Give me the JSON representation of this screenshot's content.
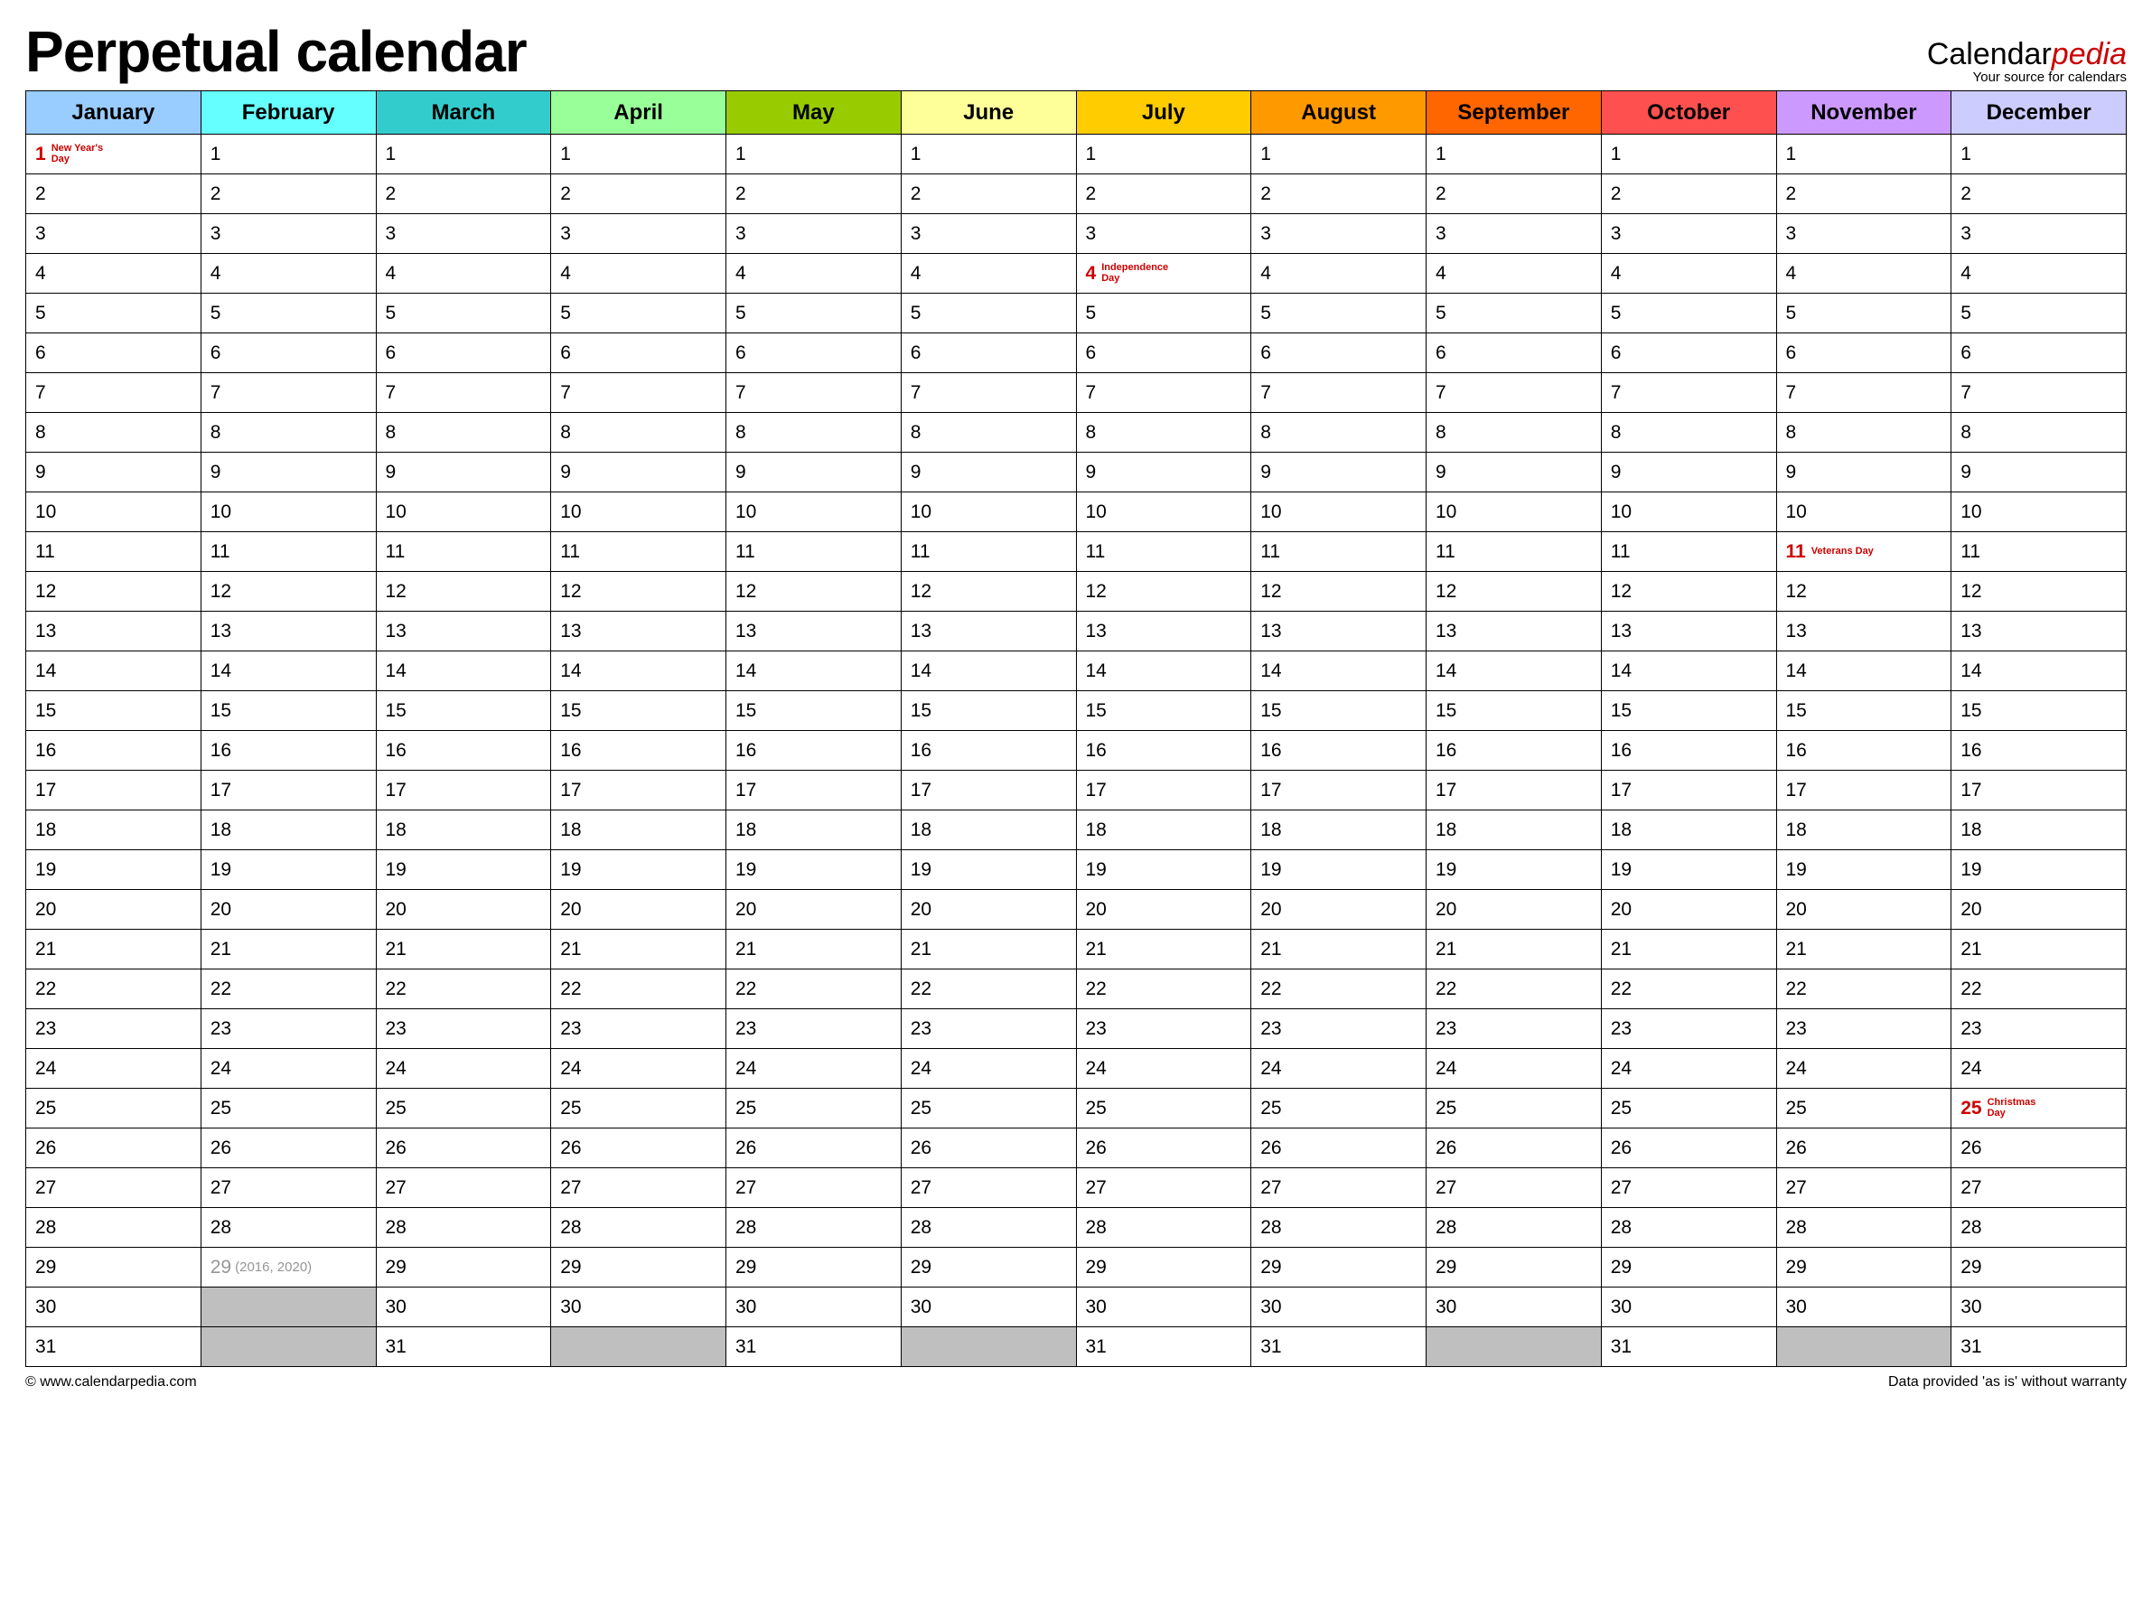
{
  "title": "Perpetual calendar",
  "brand": {
    "part1": "Calendar",
    "part2": "pedia",
    "tagline": "Your source for calendars"
  },
  "months": [
    {
      "name": "January",
      "color": "#99ccff",
      "days": 31
    },
    {
      "name": "February",
      "color": "#66ffff",
      "days": 29
    },
    {
      "name": "March",
      "color": "#33cccc",
      "days": 31
    },
    {
      "name": "April",
      "color": "#99ff99",
      "days": 30
    },
    {
      "name": "May",
      "color": "#99cc00",
      "days": 31
    },
    {
      "name": "June",
      "color": "#ffff99",
      "days": 30
    },
    {
      "name": "July",
      "color": "#ffcc00",
      "days": 31
    },
    {
      "name": "August",
      "color": "#ff9900",
      "days": 31
    },
    {
      "name": "September",
      "color": "#ff6600",
      "days": 30
    },
    {
      "name": "October",
      "color": "#ff5050",
      "days": 31
    },
    {
      "name": "November",
      "color": "#cc99ff",
      "days": 30
    },
    {
      "name": "December",
      "color": "#ccccff",
      "days": 31
    }
  ],
  "max_day": 31,
  "holidays": [
    {
      "month": 0,
      "day": 1,
      "label": "New Year's Day"
    },
    {
      "month": 6,
      "day": 4,
      "label": "Independence Day"
    },
    {
      "month": 10,
      "day": 11,
      "label": "Veterans Day"
    },
    {
      "month": 11,
      "day": 25,
      "label": "Christmas Day"
    }
  ],
  "leap": {
    "month": 1,
    "day": 29,
    "note": "(2016, 2020)"
  },
  "footer": {
    "left": "© www.calendarpedia.com",
    "right": "Data provided 'as is' without warranty"
  }
}
